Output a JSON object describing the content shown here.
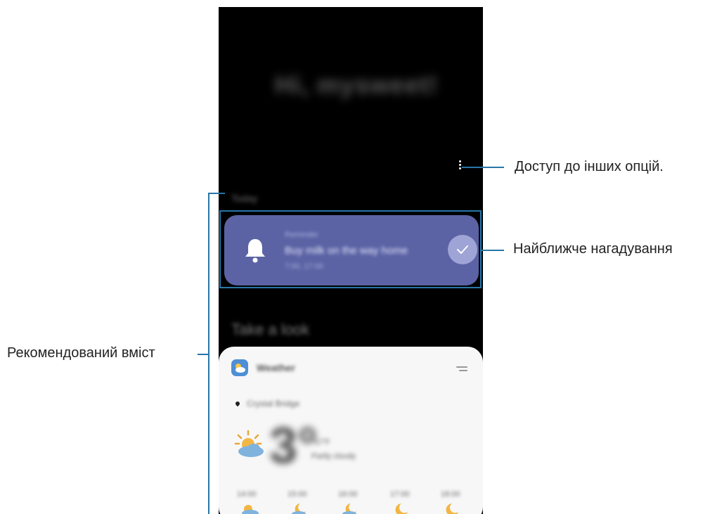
{
  "phone": {
    "greeting": "Hi, mysweet!",
    "today_label": "Today",
    "reminder": {
      "title": "Reminder",
      "body": "Buy milk on the way home",
      "time": "7:00, 17:00"
    },
    "look_label": "Take a look",
    "weather": {
      "title": "Weather",
      "location": "Crystal Bridge",
      "temperature": "3°",
      "temperature_unit": "°C/°F",
      "description": "Partly cloudy",
      "hourly": [
        {
          "time": "14:00",
          "icon": "sun-cloud-icon"
        },
        {
          "time": "15:00",
          "icon": "moon-cloud-icon"
        },
        {
          "time": "16:00",
          "icon": "moon-cloud-icon"
        },
        {
          "time": "17:00",
          "icon": "moon-icon"
        },
        {
          "time": "18:00",
          "icon": "moon-icon"
        }
      ]
    }
  },
  "annotations": {
    "more_options": "Доступ до інших опцій.",
    "nearest_reminder": "Найближче нагадування",
    "recommended_content": "Рекомендований вміст"
  },
  "colors": {
    "reminder_card": "#5b63a5",
    "annotation_line": "#2877a8",
    "phone_bg": "#000000"
  }
}
